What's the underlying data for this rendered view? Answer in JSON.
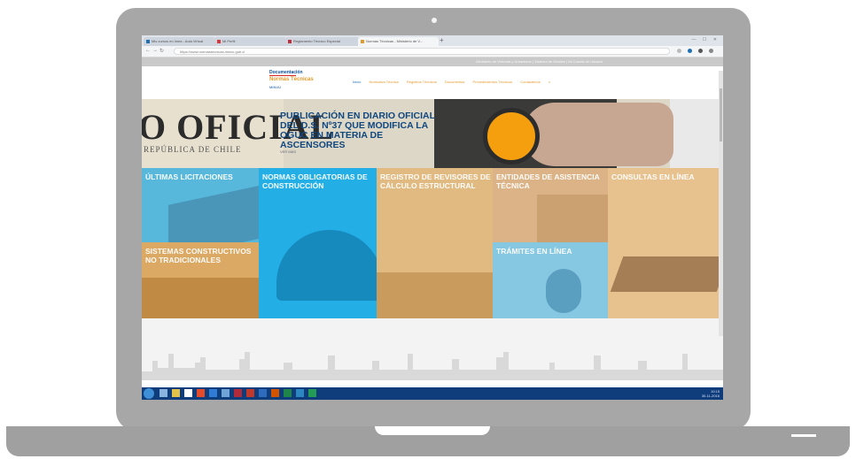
{
  "browser": {
    "tabs": [
      {
        "title": "Mis cursos en línea - Aula Virtual"
      },
      {
        "title": "Mi Perfil"
      },
      {
        "title": "Reglamento Técnico Especial"
      },
      {
        "title": "Normas Técnicas - Ministerio de V..."
      }
    ],
    "new_tab_symbol": "+",
    "window_controls": "— ☐ ✕",
    "url": "https://www.normastecnicas.minvu.gob.cl"
  },
  "site": {
    "topbar_links": "Ministerio de Vivienda y Urbanismo  |  Sistema de Gestión  |  Mi Cuenta de Usuario",
    "logo": {
      "top": "Documentación",
      "main": "Normas Técnicas",
      "sub": "MINVU"
    },
    "nav": [
      "Inicio",
      "Normativa Técnica",
      "Registros Técnicos",
      "Documentos",
      "Procedimientos Técnicos",
      "Contáctenos"
    ],
    "banner": {
      "word": "O OFICIAL",
      "subline": "REPÚBLICA DE CHILE",
      "headline": "PUBLICACIÓN EN DIARIO OFICIAL DEL D.S. Nº37 QUE MODIFICA LA OGUC EN MATERIA DE ASCENSORES",
      "more": "VER MÁS"
    },
    "tiles": [
      {
        "label": "ÚLTIMAS LICITACIONES",
        "color": "#57b8dc"
      },
      {
        "label": "NORMAS OBLIGATORIAS DE CONSTRUCCIÓN",
        "color": "#23aee6"
      },
      {
        "label": "REGISTRO DE REVISORES DE CÁLCULO ESTRUCTURAL",
        "color": "#e1ba81"
      },
      {
        "label": "ENTIDADES DE ASISTENCIA TÉCNICA",
        "color": "#dcb386"
      },
      {
        "label": "CONSULTAS EN LÍNEA",
        "color": "#e8c28e"
      },
      {
        "label": "SISTEMAS CONSTRUCTIVOS NO TRADICIONALES",
        "color": "#dba964"
      },
      {
        "label": "TRÁMITES EN LÍNEA",
        "color": "#86c7e2"
      }
    ]
  },
  "taskbar": {
    "time": "10:15",
    "date": "30-11-2016"
  }
}
